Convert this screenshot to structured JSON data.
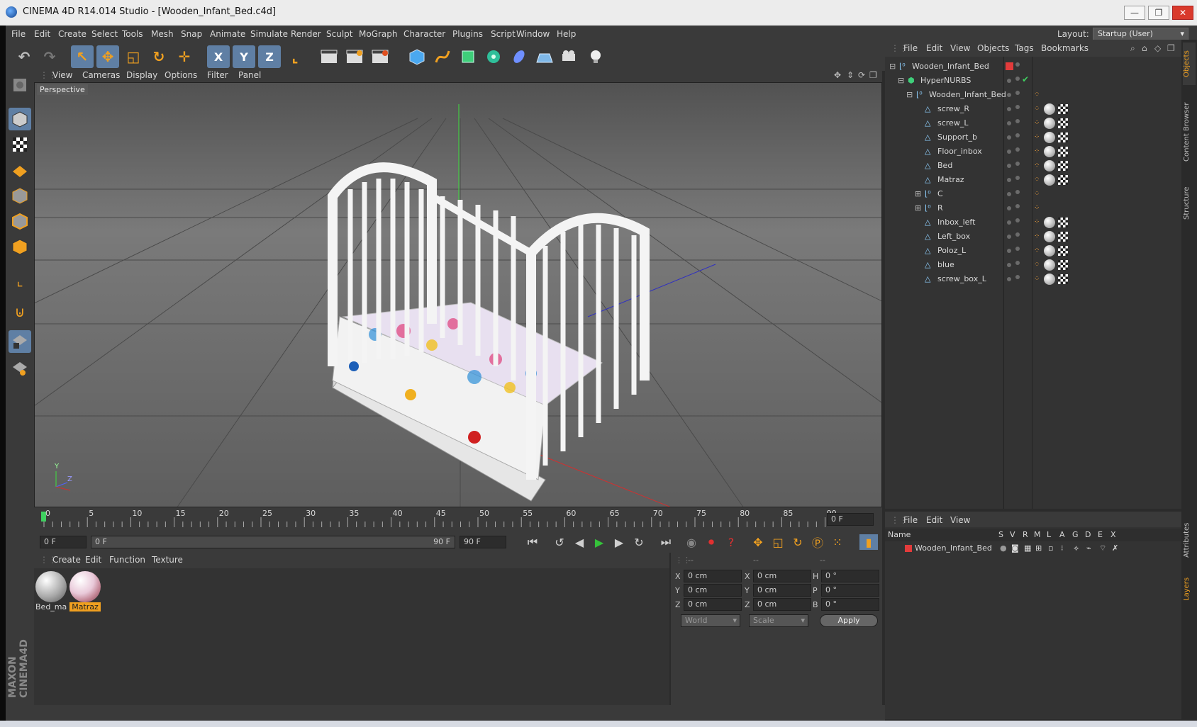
{
  "window": {
    "title": "CINEMA 4D R14.014 Studio - [Wooden_Infant_Bed.c4d]",
    "minimize": "—",
    "restore": "❐",
    "close": "✕"
  },
  "menubar": {
    "items": [
      "File",
      "Edit",
      "Create",
      "Select",
      "Tools",
      "Mesh",
      "Snap",
      "Animate",
      "Simulate",
      "Render",
      "Sculpt",
      "MoGraph",
      "Character",
      "Plugins",
      "Script",
      "Window",
      "Help"
    ],
    "layout_label": "Layout:",
    "layout_value": "Startup (User)"
  },
  "toolbar_icons": {
    "undo": "↶",
    "redo": "↷",
    "select": "↖",
    "move": "✥",
    "scale": "◱",
    "rotate": "↻",
    "add": "✛",
    "axis_x": "X",
    "axis_y": "Y",
    "axis_z": "Z",
    "coord": "⌞"
  },
  "viewport": {
    "menu": [
      "View",
      "Cameras",
      "Display",
      "Options",
      "Filter",
      "Panel"
    ],
    "label": "Perspective",
    "axis_y": "Y",
    "axis_z": "Z"
  },
  "timeline": {
    "ticks": [
      "0",
      "5",
      "10",
      "15",
      "20",
      "25",
      "30",
      "35",
      "40",
      "45",
      "50",
      "55",
      "60",
      "65",
      "70",
      "75",
      "80",
      "85",
      "90"
    ],
    "current_frame_display": "0 F",
    "start_field": "0 F",
    "range_start": "0 F",
    "range_end": "90 F",
    "end_field": "90 F"
  },
  "material_manager": {
    "menu": [
      "Create",
      "Edit",
      "Function",
      "Texture"
    ],
    "materials": [
      {
        "name": "Bed_ma",
        "selected": false
      },
      {
        "name": "Matraz",
        "selected": true
      }
    ]
  },
  "coordinates": {
    "header": [
      "--",
      "--",
      "--"
    ],
    "rows": [
      {
        "a": "X",
        "av": "0 cm",
        "b": "X",
        "bv": "0 cm",
        "c": "H",
        "cv": "0 °"
      },
      {
        "a": "Y",
        "av": "0 cm",
        "b": "Y",
        "bv": "0 cm",
        "c": "P",
        "cv": "0 °"
      },
      {
        "a": "Z",
        "av": "0 cm",
        "b": "Z",
        "bv": "0 cm",
        "c": "B",
        "cv": "0 °"
      }
    ],
    "mode": "World",
    "scale": "Scale",
    "apply": "Apply"
  },
  "objects_panel": {
    "menu": [
      "File",
      "Edit",
      "View",
      "Objects",
      "Tags",
      "Bookmarks"
    ],
    "items": [
      {
        "name": "Wooden_Infant_Bed",
        "indent": 0,
        "icon": "null",
        "expand": "⊟"
      },
      {
        "name": "HyperNURBS",
        "indent": 1,
        "icon": "nurbs",
        "expand": "⊟"
      },
      {
        "name": "Wooden_Infant_Bed",
        "indent": 2,
        "icon": "null",
        "expand": "⊟"
      },
      {
        "name": "screw_R",
        "indent": 3,
        "icon": "poly",
        "expand": ""
      },
      {
        "name": "screw_L",
        "indent": 3,
        "icon": "poly",
        "expand": ""
      },
      {
        "name": "Support_b",
        "indent": 3,
        "icon": "poly",
        "expand": ""
      },
      {
        "name": "Floor_inbox",
        "indent": 3,
        "icon": "poly",
        "expand": ""
      },
      {
        "name": "Bed",
        "indent": 3,
        "icon": "poly",
        "expand": ""
      },
      {
        "name": "Matraz",
        "indent": 3,
        "icon": "poly",
        "expand": ""
      },
      {
        "name": "C",
        "indent": 3,
        "icon": "null",
        "expand": "⊞"
      },
      {
        "name": "R",
        "indent": 3,
        "icon": "null",
        "expand": "⊞"
      },
      {
        "name": "Inbox_left",
        "indent": 3,
        "icon": "poly",
        "expand": ""
      },
      {
        "name": "Left_box",
        "indent": 3,
        "icon": "poly",
        "expand": ""
      },
      {
        "name": "Poloz_L",
        "indent": 3,
        "icon": "poly",
        "expand": ""
      },
      {
        "name": "blue",
        "indent": 3,
        "icon": "poly",
        "expand": ""
      },
      {
        "name": "screw_box_L",
        "indent": 3,
        "icon": "poly",
        "expand": ""
      }
    ]
  },
  "layers_panel": {
    "menu": [
      "File",
      "Edit",
      "View"
    ],
    "columns": [
      "Name",
      "S",
      "V",
      "R",
      "M",
      "L",
      "A",
      "G",
      "D",
      "E",
      "X"
    ],
    "rows": [
      {
        "name": "Wooden_Infant_Bed",
        "color": "#e23b3b"
      }
    ]
  },
  "right_tabs": [
    "Objects",
    "Content Browser",
    "Structure",
    "Attributes",
    "Layers"
  ],
  "brand": "MAXON CINEMA4D",
  "colors": {
    "accent": "#5f7fa4",
    "selected_material": "#f0a020",
    "play": "#35c23a"
  }
}
